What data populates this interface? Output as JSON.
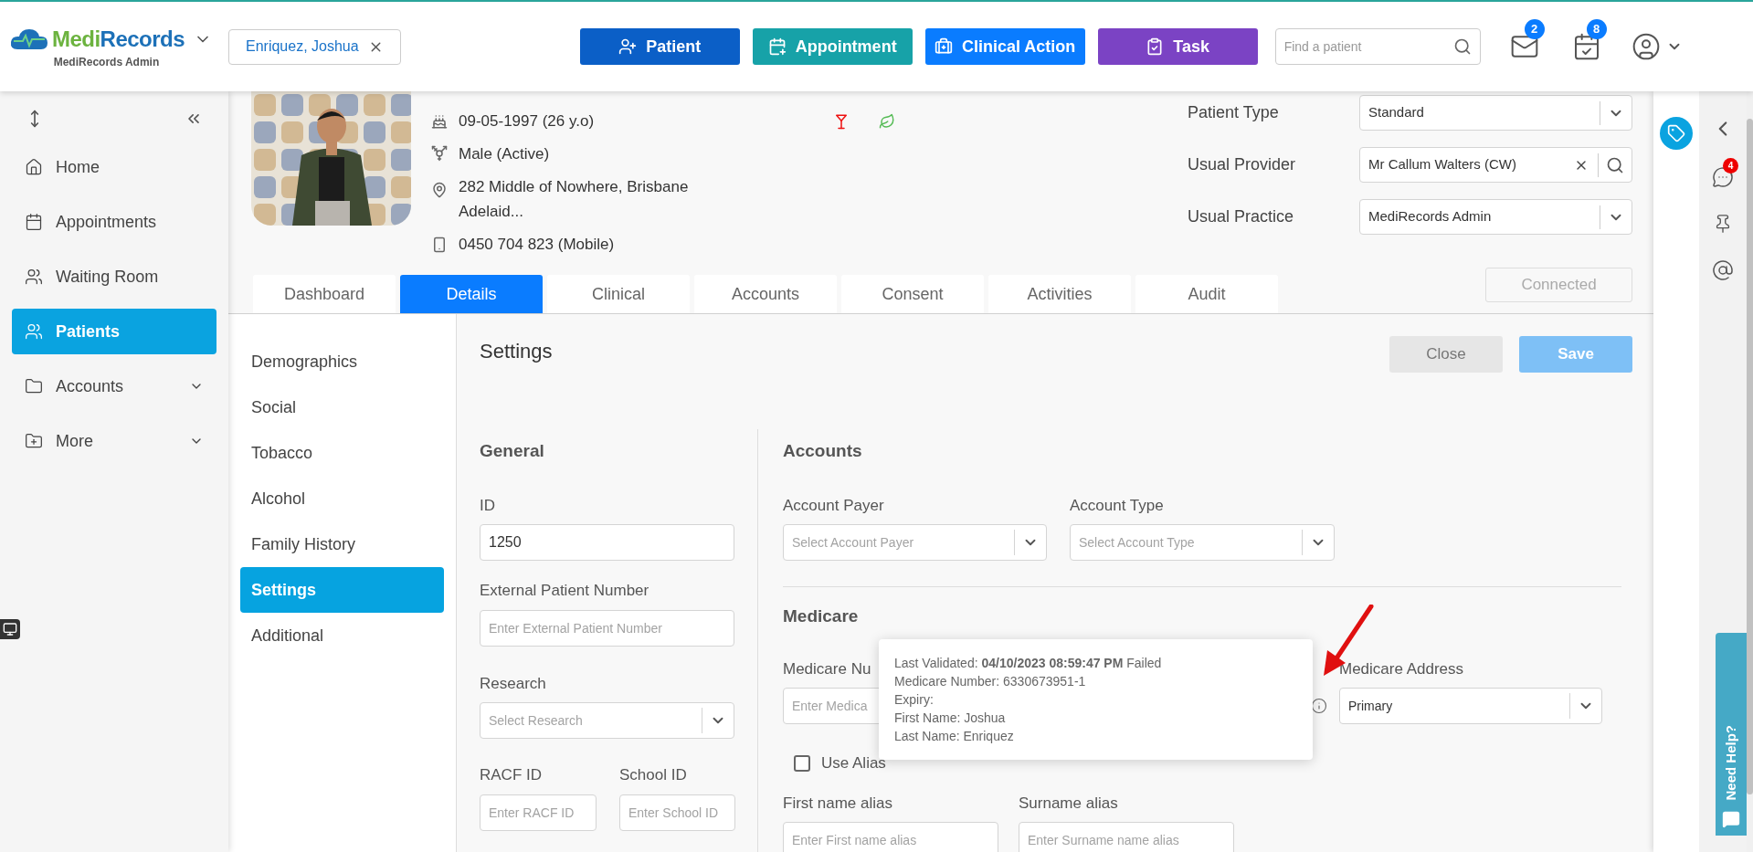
{
  "header": {
    "logo": {
      "parts": [
        {
          "text": "Medi",
          "color": "#6cb33f"
        },
        {
          "text": "Records",
          "color": "#1d71b8"
        }
      ],
      "subtitle": "MediRecords Admin"
    },
    "patient_chip": "Enriquez, Joshua",
    "actions": [
      {
        "label": "Patient",
        "kind": "patient",
        "color": "#0b5fc7"
      },
      {
        "label": "Appointment",
        "kind": "appointment",
        "color": "#17a2a8"
      },
      {
        "label": "Clinical Action",
        "kind": "clinical",
        "color": "#0a7cff"
      },
      {
        "label": "Task",
        "kind": "task",
        "color": "#7b43c4"
      }
    ],
    "search": {
      "placeholder": "Find a patient"
    },
    "mail_badge": "2",
    "tasks_badge": "8"
  },
  "sidebar": {
    "items": [
      {
        "label": "Home",
        "kind": "home",
        "selected": false,
        "expandable": false
      },
      {
        "label": "Appointments",
        "kind": "calendar",
        "selected": false,
        "expandable": false
      },
      {
        "label": "Waiting Room",
        "kind": "people",
        "selected": false,
        "expandable": false
      },
      {
        "label": "Patients",
        "kind": "people",
        "selected": true,
        "expandable": false
      },
      {
        "label": "Accounts",
        "kind": "folder",
        "selected": false,
        "expandable": true
      },
      {
        "label": "More",
        "kind": "folder-plus",
        "selected": false,
        "expandable": true
      }
    ]
  },
  "patient": {
    "dob": "09-05-1997 (26 y.o)",
    "gender": "Male (Active)",
    "address": "282 Middle of Nowhere, Brisbane Adelaid...",
    "phone": "0450 704 823 (Mobile)",
    "fields": [
      {
        "label": "Patient Type",
        "value": "Standard",
        "kind": "select"
      },
      {
        "label": "Usual Provider",
        "value": "Mr Callum Walters (CW)",
        "kind": "search"
      },
      {
        "label": "Usual Practice",
        "value": "MediRecords Admin",
        "kind": "select"
      }
    ],
    "connected": {
      "label": "Connected",
      "disabled": true
    }
  },
  "tabs": [
    {
      "label": "Dashboard",
      "selected": false
    },
    {
      "label": "Details",
      "selected": true
    },
    {
      "label": "Clinical",
      "selected": false
    },
    {
      "label": "Accounts",
      "selected": false
    },
    {
      "label": "Consent",
      "selected": false
    },
    {
      "label": "Activities",
      "selected": false
    },
    {
      "label": "Audit",
      "selected": false
    }
  ],
  "sub_nav": [
    {
      "label": "Demographics",
      "selected": false
    },
    {
      "label": "Social",
      "selected": false
    },
    {
      "label": "Tobacco",
      "selected": false
    },
    {
      "label": "Alcohol",
      "selected": false
    },
    {
      "label": "Family History",
      "selected": false
    },
    {
      "label": "Settings",
      "selected": true
    },
    {
      "label": "Additional",
      "selected": false
    }
  ],
  "settings": {
    "title": "Settings",
    "close": {
      "label": "Close",
      "disabled": false
    },
    "save": {
      "label": "Save",
      "disabled": true
    },
    "general": {
      "title": "General",
      "id": {
        "label": "ID",
        "value": "1250"
      },
      "external": {
        "label": "External Patient Number",
        "placeholder": "Enter External Patient Number"
      },
      "research": {
        "label": "Research",
        "placeholder": "Select Research"
      },
      "racf": {
        "label": "RACF ID",
        "placeholder": "Enter RACF ID"
      },
      "school": {
        "label": "School ID",
        "placeholder": "Enter School ID"
      }
    },
    "accounts": {
      "title": "Accounts",
      "payer": {
        "label": "Account Payer",
        "placeholder": "Select Account Payer"
      },
      "type": {
        "label": "Account Type",
        "placeholder": "Select Account Type"
      }
    },
    "medicare": {
      "title": "Medicare",
      "number": {
        "label": "Medicare Nu",
        "placeholder": "Enter Medica"
      },
      "address": {
        "label": "Medicare Address",
        "value": "Primary"
      },
      "tooltip": [
        "Last Validated: **04/10/2023 08:59:47 PM** Failed",
        "Medicare Number: 6330673951-1",
        "Expiry:",
        "First Name: Joshua",
        "Last Name: Enriquez"
      ],
      "use_alias": {
        "label": "Use Alias",
        "checked": false
      },
      "first_alias": {
        "label": "First name alias",
        "placeholder": "Enter First name alias"
      },
      "surname_alias": {
        "label": "Surname alias",
        "placeholder": "Enter Surname name alias"
      }
    }
  },
  "right_panel": {
    "chat_badge": "4",
    "help": "Need Help?"
  }
}
